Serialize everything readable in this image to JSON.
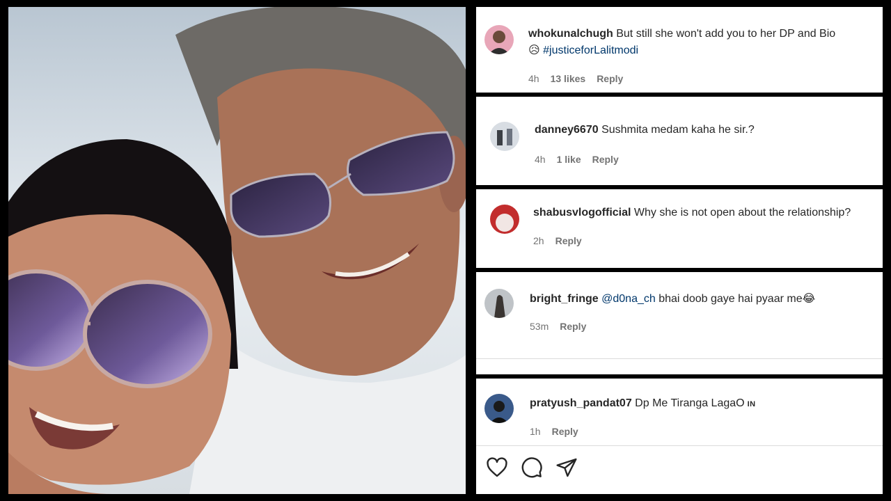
{
  "comments": [
    {
      "username": "whokunalchugh",
      "text": "But still she won't add you to her DP and Bio",
      "emoji": "😥",
      "hashtag": "#justiceforLalitmodi",
      "time": "4h",
      "likes": "13 likes",
      "reply": "Reply"
    },
    {
      "username": "danney6670",
      "text": "Sushmita medam kaha he sir.?",
      "time": "4h",
      "likes": "1 like",
      "reply": "Reply"
    },
    {
      "username": "shabusvlogofficial",
      "text": "Why she is not open about the relationship?",
      "time": "2h",
      "reply": "Reply"
    },
    {
      "username": "bright_fringe",
      "mention": "@d0na_ch",
      "text": "bhai doob gaye hai pyaar me",
      "emoji": "😂",
      "time": "53m",
      "reply": "Reply"
    },
    {
      "username": "pratyush_pandat07",
      "text": "Dp Me Tiranga LagaO",
      "subscript": "IN",
      "time": "1h",
      "reply": "Reply"
    }
  ],
  "actions": {
    "like_icon": "heart-icon",
    "comment_icon": "comment-icon",
    "share_icon": "send-icon"
  },
  "colors": {
    "background": "#000000",
    "card": "#ffffff",
    "link": "#00376b",
    "meta": "#737373",
    "text": "#262626"
  }
}
